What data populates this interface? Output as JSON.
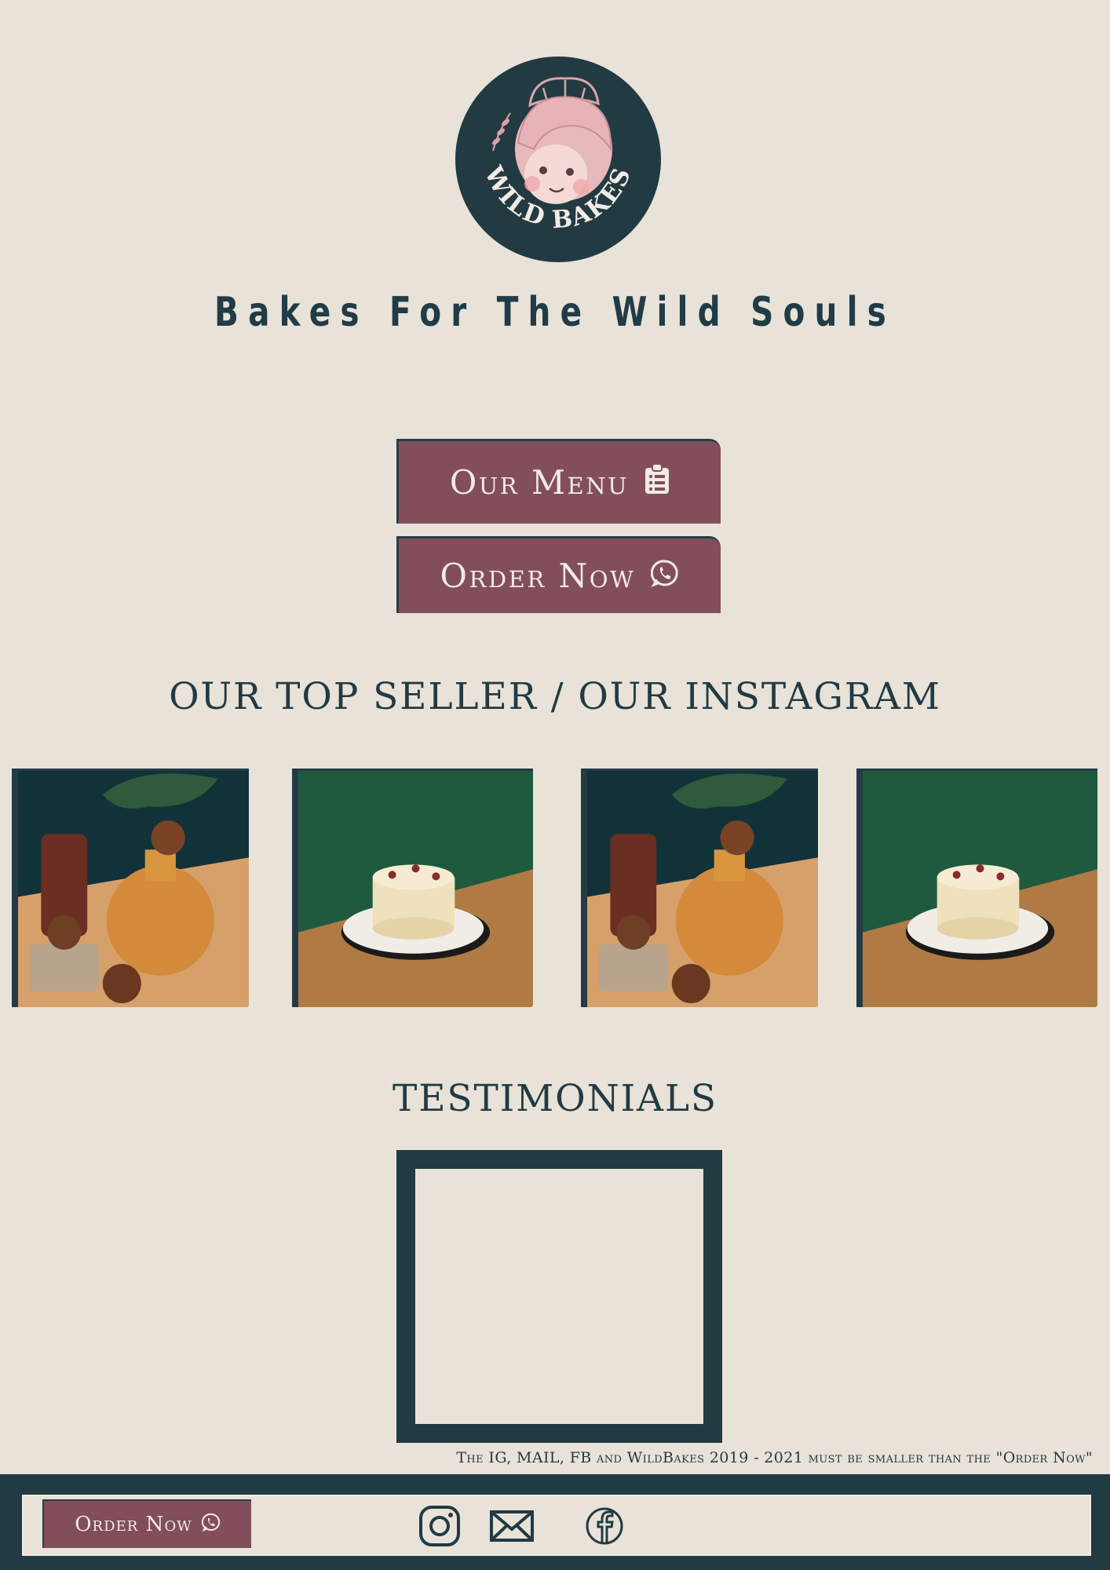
{
  "brand": {
    "logo_text": "WILD BAKES",
    "tagline": "Bakes For The Wild Souls",
    "colors": {
      "background": "#e8e2d9",
      "navy": "#223a42",
      "mauve": "#824e5a",
      "blush": "#e8b9bc"
    }
  },
  "actions": {
    "menu_label": "Our Menu",
    "menu_icon": "clipboard-list-icon",
    "order_label": "Order Now",
    "order_icon": "whatsapp-icon"
  },
  "instagram": {
    "title": "OUR TOP SELLER / OUR INSTAGRAM",
    "photos": [
      {
        "subject": "pastries-vase-scene"
      },
      {
        "subject": "layer-cake-scene"
      },
      {
        "subject": "pastries-vase-scene"
      },
      {
        "subject": "layer-cake-scene"
      }
    ]
  },
  "testimonials": {
    "title": "TESTIMONIALS"
  },
  "note": "The IG, MAIL, FB and WildBakes 2019 - 2021 must be smaller than the \"Order Now\"",
  "footer": {
    "order_label": "Order Now",
    "social": [
      "instagram-icon",
      "mail-icon",
      "facebook-icon"
    ]
  }
}
